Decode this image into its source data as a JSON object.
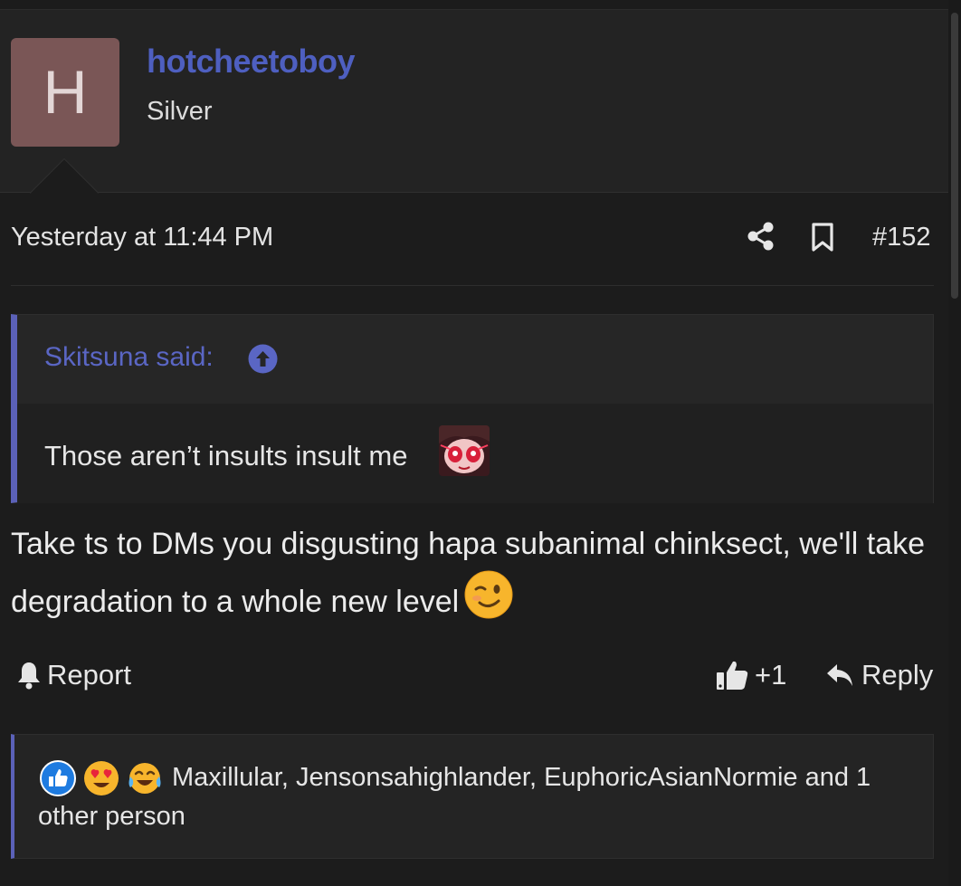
{
  "user": {
    "avatar_letter": "H",
    "avatar_color": "#7a5656",
    "username": "hotcheetoboy",
    "title": "Silver",
    "username_color": "#4e5fc0"
  },
  "post": {
    "date": "Yesterday at 11:44 PM",
    "number": "#152",
    "share_icon": "share-icon",
    "bookmark_icon": "bookmark-icon"
  },
  "quote": {
    "author": "Skitsuna said:",
    "text": "Those aren’t insults insult me",
    "accent_color": "#5b61b8"
  },
  "message": {
    "text": "Take ts to DMs you disgusting hapa subanimal chinksect, we'll take degradation to a whole new level"
  },
  "actions": {
    "report_label": "Report",
    "like_count": "+1",
    "reply_label": "Reply"
  },
  "reactions": {
    "icons": [
      "like-icon",
      "heart-eyes-icon",
      "tears-of-joy-icon"
    ],
    "text": "Maxillular, Jensonsahighlander, EuphoricAsianNormie and 1 other person"
  }
}
